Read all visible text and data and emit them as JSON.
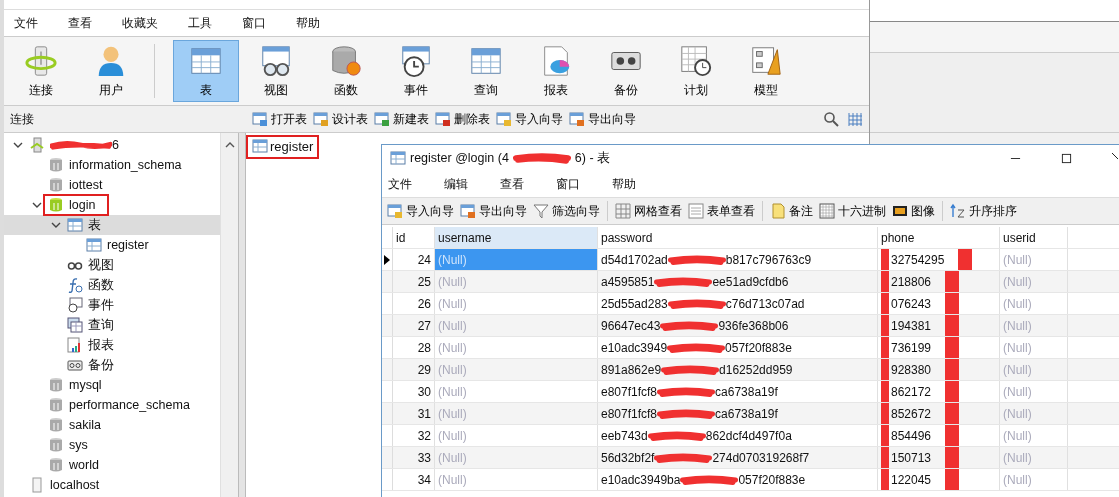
{
  "menu": [
    "文件",
    "查看",
    "收藏夹",
    "工具",
    "窗口",
    "帮助"
  ],
  "toolbar": [
    {
      "label": "连接",
      "kind": "connection",
      "selected": false
    },
    {
      "label": "用户",
      "kind": "user",
      "selected": false
    },
    {
      "label": "表",
      "kind": "table",
      "selected": true
    },
    {
      "label": "视图",
      "kind": "view",
      "selected": false
    },
    {
      "label": "函数",
      "kind": "function",
      "selected": false
    },
    {
      "label": "事件",
      "kind": "event",
      "selected": false
    },
    {
      "label": "查询",
      "kind": "query",
      "selected": false
    },
    {
      "label": "报表",
      "kind": "report",
      "selected": false
    },
    {
      "label": "备份",
      "kind": "backup",
      "selected": false
    },
    {
      "label": "计划",
      "kind": "schedule",
      "selected": false
    },
    {
      "label": "模型",
      "kind": "model",
      "selected": false
    }
  ],
  "panel_label": "连接",
  "object_actions": [
    {
      "label": "打开表",
      "kind": "open"
    },
    {
      "label": "设计表",
      "kind": "design"
    },
    {
      "label": "新建表",
      "kind": "new"
    },
    {
      "label": "删除表",
      "kind": "delete"
    },
    {
      "label": "导入向导",
      "kind": "import"
    },
    {
      "label": "导出向导",
      "kind": "export"
    }
  ],
  "tree": [
    {
      "label": "6",
      "kind": "connection",
      "redacted": true,
      "expanded": true,
      "selected": false,
      "highlighted": false,
      "children": [
        {
          "label": "information_schema",
          "kind": "database",
          "expanded": false,
          "selected": false,
          "highlighted": false
        },
        {
          "label": "iottest",
          "kind": "database",
          "expanded": false,
          "selected": false,
          "highlighted": false
        },
        {
          "label": "login",
          "kind": "database",
          "expanded": true,
          "selected": false,
          "highlighted": true,
          "children": [
            {
              "label": "表",
              "kind": "tables",
              "expanded": true,
              "selected": true,
              "highlighted": false,
              "children": [
                {
                  "label": "register",
                  "kind": "table",
                  "selected": false,
                  "highlighted": false
                }
              ]
            },
            {
              "label": "视图",
              "kind": "views",
              "selected": false,
              "highlighted": false
            },
            {
              "label": "函数",
              "kind": "functions",
              "selected": false,
              "highlighted": false
            },
            {
              "label": "事件",
              "kind": "events",
              "selected": false,
              "highlighted": false
            },
            {
              "label": "查询",
              "kind": "queries",
              "selected": false,
              "highlighted": false
            },
            {
              "label": "报表",
              "kind": "reports",
              "selected": false,
              "highlighted": false
            },
            {
              "label": "备份",
              "kind": "backups",
              "selected": false,
              "highlighted": false
            }
          ]
        },
        {
          "label": "mysql",
          "kind": "database",
          "expanded": false,
          "selected": false,
          "highlighted": false
        },
        {
          "label": "performance_schema",
          "kind": "database",
          "expanded": false,
          "selected": false,
          "highlighted": false
        },
        {
          "label": "sakila",
          "kind": "database",
          "expanded": false,
          "selected": false,
          "highlighted": false
        },
        {
          "label": "sys",
          "kind": "database",
          "expanded": false,
          "selected": false,
          "highlighted": false
        },
        {
          "label": "world",
          "kind": "database",
          "expanded": false,
          "selected": false,
          "highlighted": false
        }
      ]
    },
    {
      "label": "localhost",
      "kind": "connection",
      "selected": false,
      "highlighted": false
    }
  ],
  "objects": [
    {
      "label": "register",
      "highlighted": true
    }
  ],
  "table_window": {
    "title_start": "register @login (4",
    "title_end": "6) - 表",
    "menu": [
      "文件",
      "编辑",
      "查看",
      "窗口",
      "帮助"
    ],
    "toolbar": [
      {
        "label": "导入向导",
        "kind": "import"
      },
      {
        "label": "导出向导",
        "kind": "export"
      },
      {
        "label": "筛选向导",
        "kind": "filter"
      },
      {
        "label": "网格查看",
        "kind": "grid"
      },
      {
        "label": "表单查看",
        "kind": "form"
      },
      {
        "label": "备注",
        "kind": "memo"
      },
      {
        "label": "十六进制",
        "kind": "hex"
      },
      {
        "label": "图像",
        "kind": "image"
      },
      {
        "label": "升序排序",
        "kind": "sort"
      }
    ],
    "columns": [
      {
        "label": "id",
        "selected": false
      },
      {
        "label": "username",
        "selected": true
      },
      {
        "label": "password",
        "selected": false
      },
      {
        "label": "phone",
        "selected": false
      },
      {
        "label": "userid",
        "selected": false
      }
    ],
    "rows": [
      {
        "id": "24",
        "username": "(Null)",
        "password_start": "d54d1702ad",
        "password_end": "b817c796763c9",
        "phone": "32754295",
        "userid": "(Null)",
        "selected": true
      },
      {
        "id": "25",
        "username": "(Null)",
        "password_start": "a4595851",
        "password_end": "ee51ad9cfdb6",
        "phone": "218806",
        "userid": "(Null)",
        "selected": false
      },
      {
        "id": "26",
        "username": "(Null)",
        "password_start": "25d55ad283",
        "password_end": "c76d713c07ad",
        "phone": "076243",
        "userid": "(Null)",
        "selected": false
      },
      {
        "id": "27",
        "username": "(Null)",
        "password_start": "96647ec43",
        "password_end": "936fe368b06",
        "phone": "194381",
        "userid": "(Null)",
        "selected": false
      },
      {
        "id": "28",
        "username": "(Null)",
        "password_start": "e10adc3949",
        "password_end": "057f20f883e",
        "phone": "736199",
        "userid": "(Null)",
        "selected": false
      },
      {
        "id": "29",
        "username": "(Null)",
        "password_start": "891a862e9",
        "password_end": "d16252dd959",
        "phone": "928380",
        "userid": "(Null)",
        "selected": false
      },
      {
        "id": "30",
        "username": "(Null)",
        "password_start": "e807f1fcf8",
        "password_end": "ca6738a19f",
        "phone": "862172",
        "userid": "(Null)",
        "selected": false
      },
      {
        "id": "31",
        "username": "(Null)",
        "password_start": "e807f1fcf8",
        "password_end": "ca6738a19f",
        "phone": "852672",
        "userid": "(Null)",
        "selected": false
      },
      {
        "id": "32",
        "username": "(Null)",
        "password_start": "eeb743d",
        "password_end": "862dcf4d497f0a",
        "phone": "854496",
        "userid": "(Null)",
        "selected": false
      },
      {
        "id": "33",
        "username": "(Null)",
        "password_start": "56d32bf2f",
        "password_end": "274d070319268f7",
        "phone": "150713",
        "userid": "(Null)",
        "selected": false
      },
      {
        "id": "34",
        "username": "(Null)",
        "password_start": "e10adc3949ba",
        "password_end": "057f20f883e",
        "phone": "122045",
        "userid": "(Null)",
        "selected": false
      }
    ]
  }
}
